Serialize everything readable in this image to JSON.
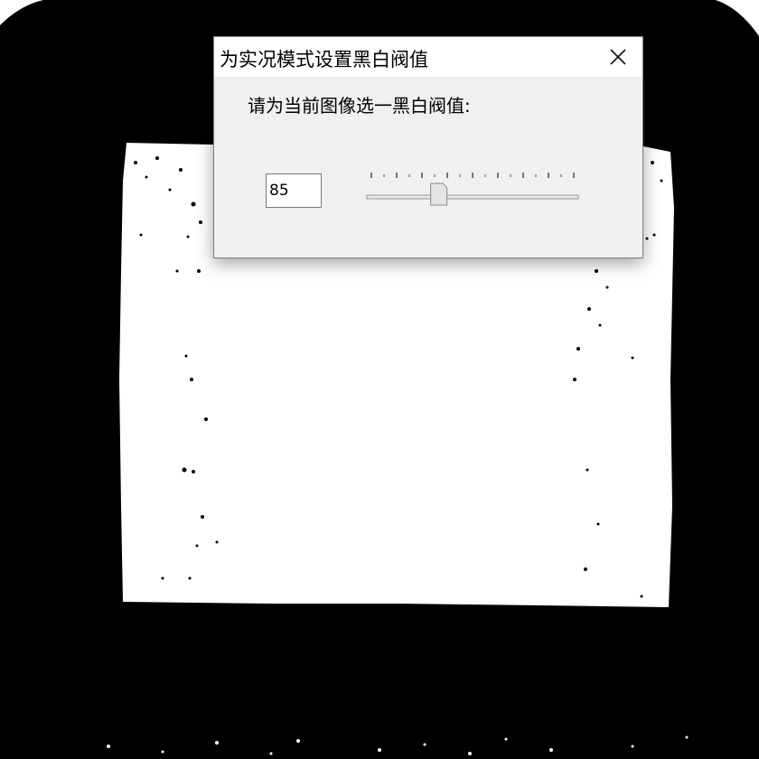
{
  "dialog": {
    "title": "为实况模式设置黑白阀值",
    "prompt": "请为当前图像选一黑白阀值:",
    "threshold_value": "85",
    "slider": {
      "min": 0,
      "max": 255,
      "value": 85,
      "tick_count": 9
    }
  },
  "icons": {
    "close": "close-icon"
  },
  "colors": {
    "dialog_bg": "#f0f0f0",
    "titlebar_bg": "#ffffff",
    "preview_bg": "#000000",
    "preview_fg": "#ffffff"
  }
}
